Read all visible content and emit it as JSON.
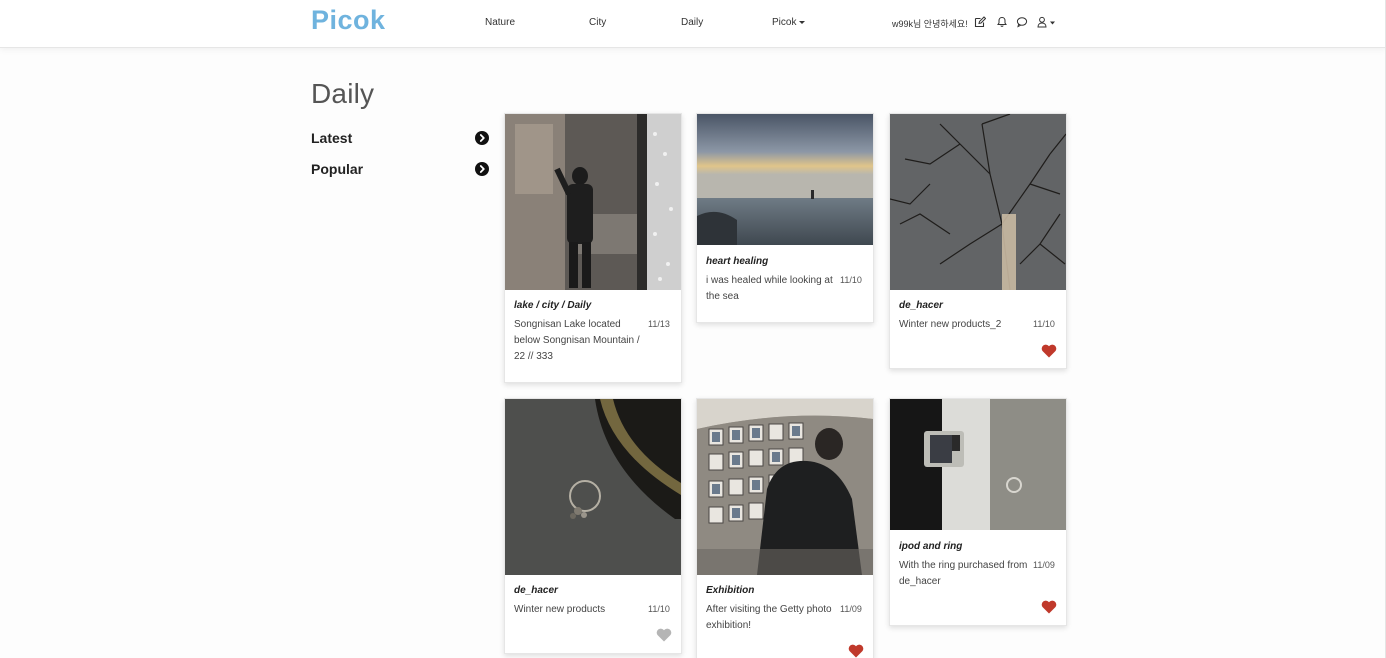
{
  "nav": {
    "brand": "Picok",
    "links": [
      "Nature",
      "City",
      "Daily"
    ],
    "dropdown_label": "Picok",
    "greeting": "w99k님 안녕하세요!",
    "icons": [
      "edit-icon",
      "bell-icon",
      "chat-icon",
      "user-icon"
    ]
  },
  "page": {
    "title": "Daily"
  },
  "sidebar": {
    "items": [
      {
        "label": "Latest",
        "icon": "chevron-right-circle-icon"
      },
      {
        "label": "Popular",
        "icon": "chevron-right-circle-icon"
      }
    ]
  },
  "colors": {
    "brand": "#6fb3de",
    "heart_liked": "#c0392b",
    "heart_unliked": "#b5b5b5"
  },
  "posts": [
    {
      "title": "lake / city / Daily",
      "description": "Songnisan Lake located below Songnisan Mountain / 22 // 333",
      "date": "11/13",
      "heart": "none"
    },
    {
      "title": "heart healing",
      "description": "i was healed while looking at the sea",
      "date": "11/10",
      "heart": "none"
    },
    {
      "title": "de_hacer",
      "description": "Winter new products_2",
      "date": "11/10",
      "heart": "liked"
    },
    {
      "title": "de_hacer",
      "description": "Winter new products",
      "date": "11/10",
      "heart": "unliked"
    },
    {
      "title": "Exhibition",
      "description": "After visiting the Getty photo exhibition!",
      "date": "11/09",
      "heart": "liked"
    },
    {
      "title": "ipod and ring",
      "description": "With the ring purchased from de_hacer",
      "date": "11/09",
      "heart": "liked"
    }
  ]
}
